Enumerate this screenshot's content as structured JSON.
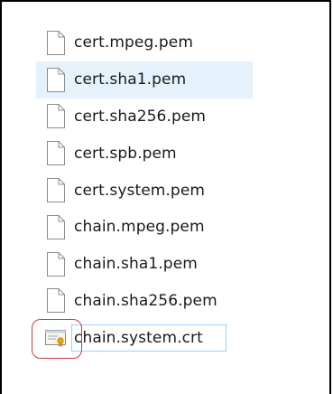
{
  "files": [
    {
      "name": "cert.mpeg.pem",
      "icon": "document-icon"
    },
    {
      "name": "cert.sha1.pem",
      "icon": "document-icon",
      "state": "hover"
    },
    {
      "name": "cert.sha256.pem",
      "icon": "document-icon"
    },
    {
      "name": "cert.spb.pem",
      "icon": "document-icon"
    },
    {
      "name": "cert.system.pem",
      "icon": "document-icon"
    },
    {
      "name": "chain.mpeg.pem",
      "icon": "document-icon"
    },
    {
      "name": "chain.sha1.pem",
      "icon": "document-icon"
    },
    {
      "name": "chain.sha256.pem",
      "icon": "document-icon"
    },
    {
      "name": "chain.system.crt",
      "icon": "certificate-icon",
      "state": "selected"
    }
  ],
  "colors": {
    "hover_bg": "#e5f1fb",
    "selection_border": "#99d1ff",
    "annotation_ring": "#c83c3c"
  }
}
